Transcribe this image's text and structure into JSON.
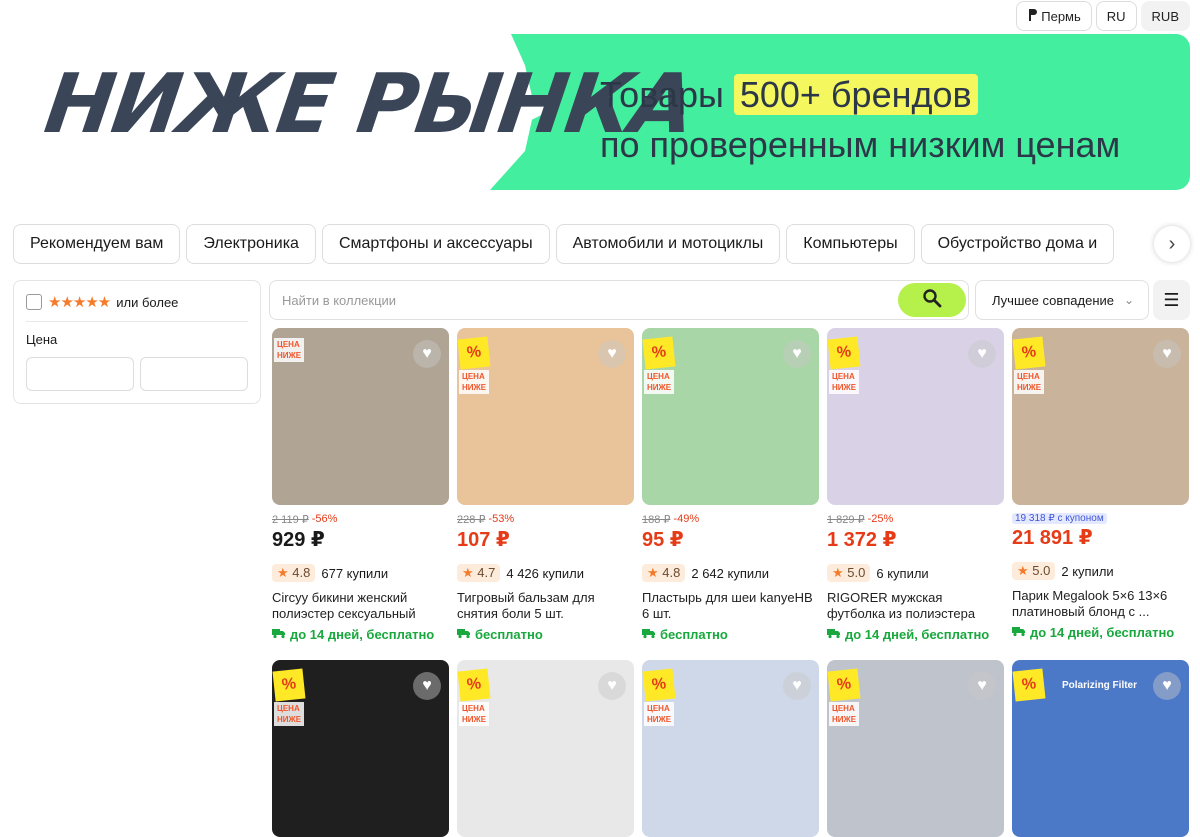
{
  "topbar": {
    "city": "Пермь",
    "lang": "RU",
    "currency": "RUB"
  },
  "banner": {
    "logo": "НИЖЕ РЫНКА",
    "line1_prefix": "Товары ",
    "line1_highlight": "500+ брендов",
    "line2": "по проверенным низким ценам",
    "colors": {
      "green": "#43ee9e",
      "highlight": "#f5f75e",
      "text": "#2c3848"
    }
  },
  "categories": [
    "Рекомендуем вам",
    "Электроника",
    "Смартфоны и аксессуары",
    "Автомобили и мотоциклы",
    "Компьютеры",
    "Обустройство дома и"
  ],
  "filter": {
    "rating_label": "или более",
    "rating_stars": "★★★★★",
    "price_label": "Цена"
  },
  "search": {
    "placeholder": "Найти в коллекции",
    "sort_label": "Лучшее совпадение"
  },
  "badges": {
    "nizhe": "ЦЕНА НИЖЕ",
    "percent": "%"
  },
  "products": [
    {
      "old_price": "2 119 ₽",
      "discount": "-56%",
      "price": "929 ₽",
      "price_red": false,
      "rating": "4.8",
      "sold": "677 купили",
      "title": "Circyy бикини женский полиэстер сексуальный",
      "shipping": "до 14 дней, бесплатно",
      "img_color": "#b0a494",
      "pct": false
    },
    {
      "old_price": "228 ₽",
      "discount": "-53%",
      "price": "107 ₽",
      "price_red": true,
      "rating": "4.7",
      "sold": "4 426 купили",
      "title": "Тигровый бальзам для снятия боли 5 шт.",
      "shipping": "бесплатно",
      "img_color": "#e9c39a",
      "pct": true
    },
    {
      "old_price": "188 ₽",
      "discount": "-49%",
      "price": "95 ₽",
      "price_red": true,
      "rating": "4.8",
      "sold": "2 642 купили",
      "title": "Пластырь для шеи kanyeHB 6 шт.",
      "shipping": "бесплатно",
      "img_color": "#a9d6a6",
      "pct": true
    },
    {
      "old_price": "1 829 ₽",
      "discount": "-25%",
      "price": "1 372 ₽",
      "price_red": true,
      "rating": "5.0",
      "sold": "6 купили",
      "title": "RIGORER мужская футболка из полиэстера",
      "shipping": "до 14 дней, бесплатно",
      "img_color": "#d9d2e6",
      "pct": true
    },
    {
      "coupon": "19 318 ₽ с купоном",
      "price": "21 891 ₽",
      "price_red": true,
      "rating": "5.0",
      "sold": "2 купили",
      "title": "Парик Megalook 5×6 13×6 платиновый блонд с ...",
      "shipping": "до 14 дней, бесплатно",
      "img_color": "#c9b39a",
      "pct": true
    }
  ],
  "products_row2": [
    {
      "img_color": "#1f1f1f"
    },
    {
      "img_color": "#e8e8e8"
    },
    {
      "img_color": "#cfd8e8"
    },
    {
      "img_color": "#bfc4cc"
    },
    {
      "img_color": "#4c78c8",
      "label": "Polarizing Filter"
    }
  ]
}
